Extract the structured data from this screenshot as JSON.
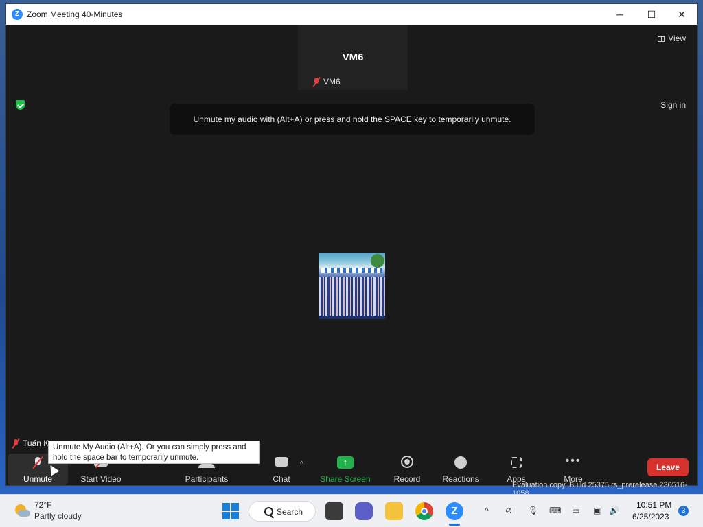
{
  "window": {
    "title": "Zoom Meeting 40-Minutes",
    "app_icon": "Z",
    "controls": {
      "minimize": "─",
      "maximize": "☐",
      "close": "✕"
    }
  },
  "meeting": {
    "participant_tile": {
      "display_name": "VM6",
      "label": "VM6",
      "muted": true
    },
    "view_label": "View",
    "sign_in_label": "Sign in",
    "unmute_banner": "Unmute my audio with (Alt+A) or press and hold the SPACE key to temporarily unmute.",
    "self_name": "Tuấn K",
    "evaluation_text": "Evaluation copy. Build 25375.rs_prerelease.230516-1058"
  },
  "toolbar": {
    "unmute": "Unmute",
    "start_video": "Start Video",
    "participants": "Participants",
    "chat": "Chat",
    "chat_caret": "^",
    "share_screen": "Share Screen",
    "share_arrow": "↑",
    "record": "Record",
    "reactions": "Reactions",
    "apps": "Apps",
    "more": "More",
    "more_dots": "•••",
    "leave": "Leave"
  },
  "tooltip": {
    "text": "Unmute My Audio (Alt+A). Or you can simply press and hold the space bar to temporarily unmute."
  },
  "taskbar": {
    "weather": {
      "temp": "72°F",
      "condition": "Partly cloudy"
    },
    "search_label": "Search",
    "zoom_icon": "Z",
    "tray": {
      "chevron": "^",
      "network": "⊘",
      "mic": "🎙",
      "keyboard": "⌨",
      "display": "▭",
      "devices": "▣",
      "volume": "🔊"
    },
    "clock": {
      "time": "10:51 PM",
      "date": "6/25/2023"
    },
    "notification_count": "3"
  },
  "colors": {
    "accent_blue": "#2d8cff",
    "share_green": "#22b24c",
    "leave_red": "#d8322f",
    "mute_red": "#e04040",
    "security_green": "#1fbf4c"
  }
}
